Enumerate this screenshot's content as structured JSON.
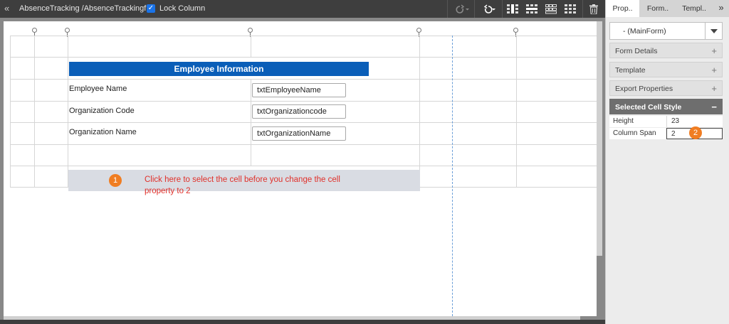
{
  "toolbar": {
    "breadcrumb": "AbsenceTracking /AbsenceTrackingfrm",
    "lock_column_label": "Lock Column",
    "lock_column_checked": true,
    "icons": [
      "collapse-icon",
      "redo-icon",
      "undo-icon",
      "insert-column-icon",
      "insert-row-icon",
      "merge-cells-icon",
      "split-cells-icon",
      "delete-icon"
    ]
  },
  "form": {
    "header": "Employee Information",
    "rows": [
      {
        "label": "Employee Name",
        "control": "txtEmployeeName"
      },
      {
        "label": "Organization Code",
        "control": "txtOrganizationcode"
      },
      {
        "label": "Organization Name",
        "control": "txtOrganizationName"
      }
    ],
    "annotation": {
      "badge": "1",
      "text": "Click here to select the cell before you change the cell property to 2"
    },
    "colors": {
      "header_bg": "#0a5eb8",
      "annotation": "#e0302a",
      "badge": "#f07d22",
      "selected_cell": "#d9dce3"
    }
  },
  "panel": {
    "tabs": [
      {
        "label": "Prop..",
        "active": true
      },
      {
        "label": "Form..",
        "active": false
      },
      {
        "label": "Templ..",
        "active": false
      }
    ],
    "more_icon": "double-chevron-right-icon",
    "form_select": {
      "value": "- (MainForm)"
    },
    "sections": [
      {
        "label": "Form Details",
        "expanded": false
      },
      {
        "label": "Template",
        "expanded": false
      },
      {
        "label": "Export Properties",
        "expanded": false
      },
      {
        "label": "Selected Cell Style",
        "expanded": true
      }
    ],
    "properties": [
      {
        "name": "Height",
        "value": "23"
      },
      {
        "name": "Column Span",
        "value": "2"
      }
    ],
    "span_badge": "2"
  }
}
